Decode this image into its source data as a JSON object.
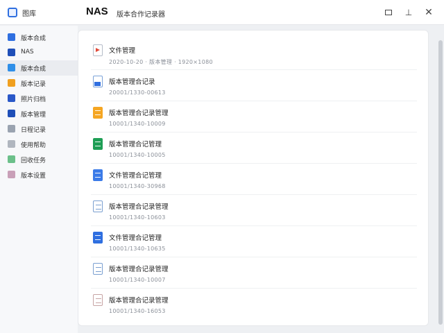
{
  "window": {
    "app_title": "图库",
    "nas_title": "NAS",
    "subtitle": "版本合作记录器"
  },
  "sidebar": {
    "items": [
      {
        "label": "版本合成",
        "color": "#2f6fe0",
        "active": false
      },
      {
        "label": "NAS",
        "color": "#1f4fb8",
        "active": false
      },
      {
        "label": "版本合成",
        "color": "#2f8fe8",
        "active": true
      },
      {
        "label": "版本记录",
        "color": "#f0a020",
        "active": false
      },
      {
        "label": "照片归档",
        "color": "#2a58c8",
        "active": false
      },
      {
        "label": "版本管理",
        "color": "#1f4fb8",
        "active": false
      },
      {
        "label": "日程记录",
        "color": "#9aa3b0",
        "active": false
      },
      {
        "label": "使用帮助",
        "color": "#b0b6bf",
        "active": false
      },
      {
        "label": "回收任务",
        "color": "#6cc08a",
        "active": false
      },
      {
        "label": "版本设置",
        "color": "#c9a0b8",
        "active": false
      }
    ]
  },
  "files": [
    {
      "title": "文件管理",
      "meta": "2020-10-20 · 版本管理 · 1920×1080",
      "icon": "red"
    },
    {
      "title": "版本管理合记录",
      "meta": "20001/1330-00613",
      "icon": "blue-doc"
    },
    {
      "title": "版本管理合记录管理",
      "meta": "10001/1340-10009",
      "icon": "orange",
      "color": "#f5a623"
    },
    {
      "title": "版本管理合记管理",
      "meta": "10001/1340-10005",
      "icon": "green",
      "color": "#1e9e55"
    },
    {
      "title": "文件管理合记管理",
      "meta": "10001/1340-30968",
      "icon": "blue",
      "color": "#3b7be8"
    },
    {
      "title": "版本管理合记录管理",
      "meta": "10001/1340-10603",
      "icon": "outline"
    },
    {
      "title": "文件管理合记管理",
      "meta": "10001/1340-10635",
      "icon": "blue",
      "color": "#2f6fe0"
    },
    {
      "title": "版本管理合记录管理",
      "meta": "10001/1340-10007",
      "icon": "outline"
    },
    {
      "title": "版本管理合记录管理",
      "meta": "10001/1340-16053",
      "icon": "outline-light"
    }
  ]
}
